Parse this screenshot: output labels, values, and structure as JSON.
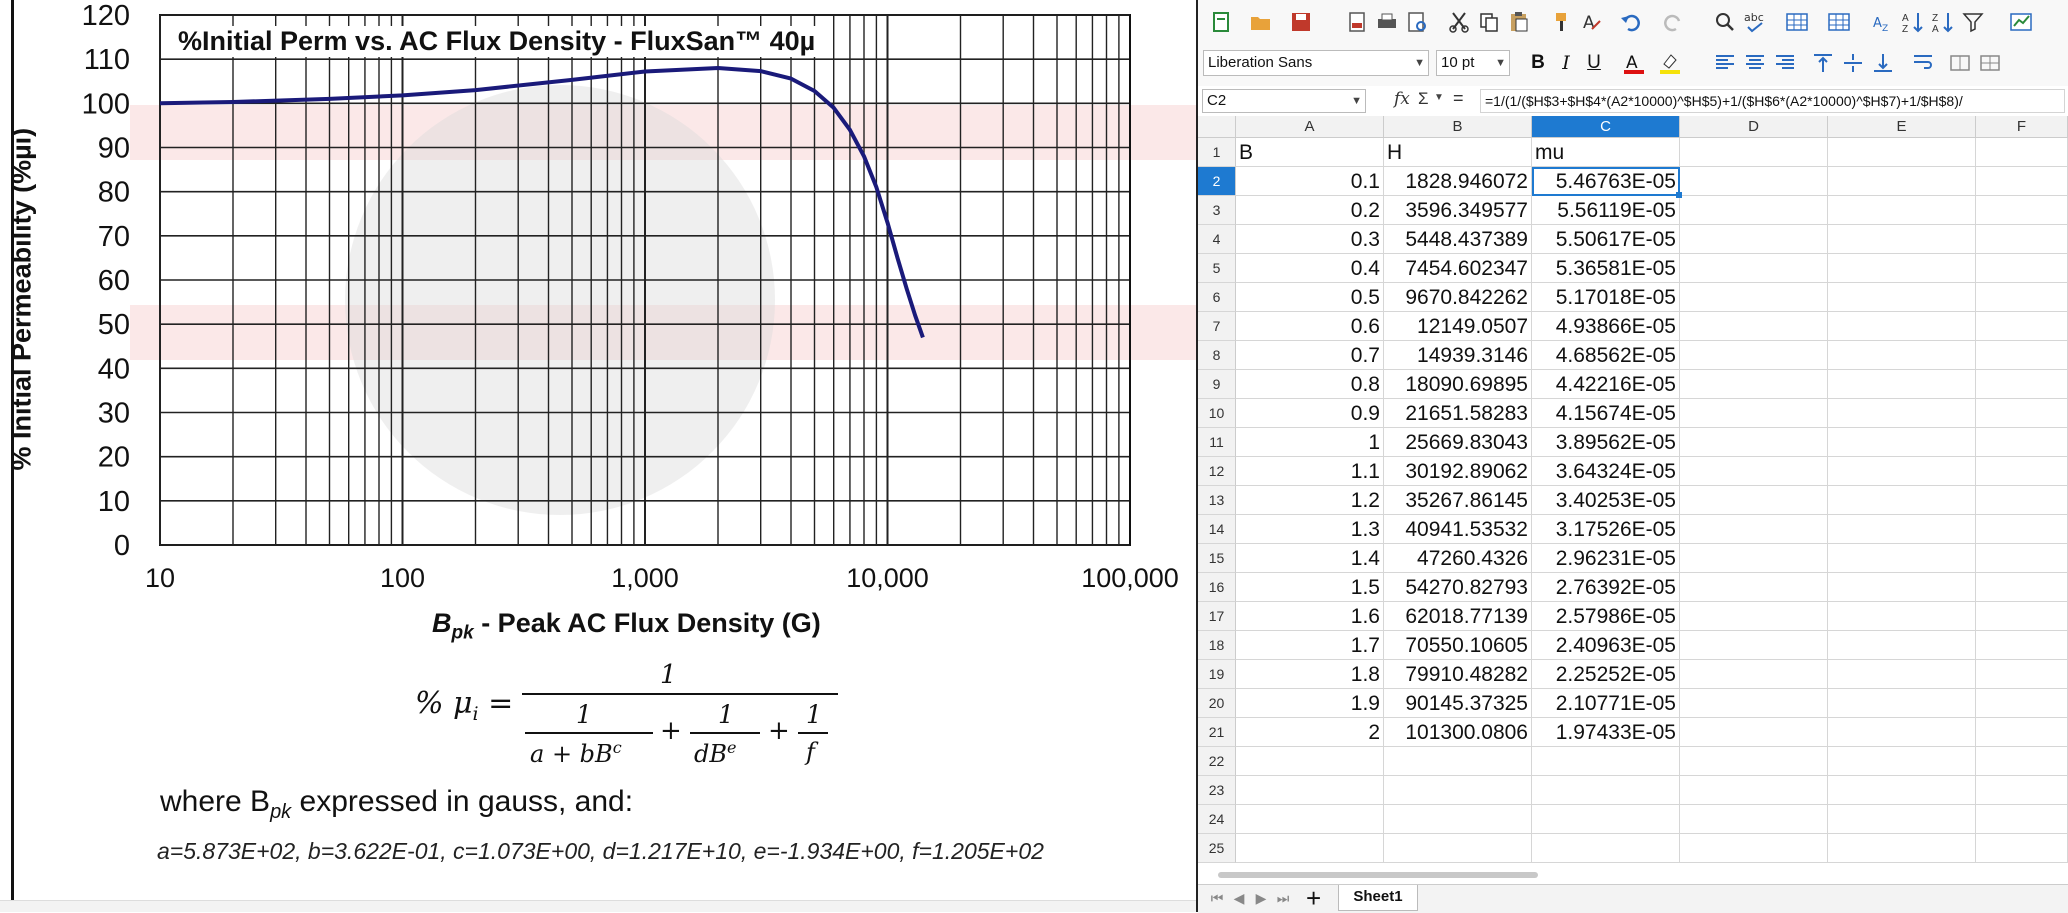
{
  "chart_data": {
    "type": "line",
    "title": "%Initial Perm vs. AC Flux Density - FluxSan™ 40µ",
    "xlabel": "B<sub>pk</sub> - Peak AC Flux Density (G)",
    "xlabel_main": "B",
    "xlabel_sub": "pk",
    "xlabel_rest": " - Peak AC Flux Density (G)",
    "ylabel": "% Initial Permeability (%µi)",
    "xscale": "log",
    "xlim": [
      10,
      100000
    ],
    "ylim": [
      0,
      120
    ],
    "x_ticks": [
      "10",
      "100",
      "1,000",
      "10,000",
      "100,000"
    ],
    "y_ticks": [
      "0",
      "10",
      "20",
      "30",
      "40",
      "50",
      "60",
      "70",
      "80",
      "90",
      "100",
      "110",
      "120"
    ],
    "grid": true,
    "series": [
      {
        "color": "#1a1a7a",
        "x": [
          10,
          20,
          50,
          100,
          200,
          500,
          1000,
          2000,
          3000,
          4000,
          5000,
          6000,
          7000,
          8000,
          9000,
          10000,
          11000,
          12000,
          13000,
          14000
        ],
        "y": [
          100,
          100.3,
          101,
          101.8,
          103,
          105.3,
          107.2,
          108,
          107.3,
          105.6,
          102.8,
          99,
          94,
          88,
          81,
          73,
          65,
          58,
          52,
          47
        ]
      }
    ]
  },
  "formula": {
    "lhs": "% μ",
    "lhs_sub": "i",
    "numerator": "1",
    "term1_num": "1",
    "term1_den": "a + bB",
    "term1_exp": "c",
    "term2_num": "1",
    "term2_den": "dB",
    "term2_exp": "e",
    "term3_num": "1",
    "term3_den": "f"
  },
  "description": {
    "line1_pre": "where B",
    "line1_sub": "pk",
    "line1_post": " expressed in gauss, and:",
    "coefficients": "a=5.873E+02, b=3.622E-01, c=1.073E+00, d=1.217E+10, e=-1.934E+00, f=1.205E+02"
  },
  "spreadsheet": {
    "font_name": "Liberation Sans",
    "font_size": "10 pt",
    "name_box": "C2",
    "formula": "=1/(1/($H$3+$H$4*(A2*10000)^$H$5)+1/($H$6*(A2*10000)^$H$7)+1/$H$8)/",
    "columns": [
      "A",
      "B",
      "C",
      "D",
      "E",
      "F"
    ],
    "headers": [
      "B",
      "H",
      "mu"
    ],
    "rows": [
      [
        "0.1",
        "1828.946072",
        "5.46763E-05"
      ],
      [
        "0.2",
        "3596.349577",
        "5.56119E-05"
      ],
      [
        "0.3",
        "5448.437389",
        "5.50617E-05"
      ],
      [
        "0.4",
        "7454.602347",
        "5.36581E-05"
      ],
      [
        "0.5",
        "9670.842262",
        "5.17018E-05"
      ],
      [
        "0.6",
        "12149.0507",
        "4.93866E-05"
      ],
      [
        "0.7",
        "14939.3146",
        "4.68562E-05"
      ],
      [
        "0.8",
        "18090.69895",
        "4.42216E-05"
      ],
      [
        "0.9",
        "21651.58283",
        "4.15674E-05"
      ],
      [
        "1",
        "25669.83043",
        "3.89562E-05"
      ],
      [
        "1.1",
        "30192.89062",
        "3.64324E-05"
      ],
      [
        "1.2",
        "35267.86145",
        "3.40253E-05"
      ],
      [
        "1.3",
        "40941.53532",
        "3.17526E-05"
      ],
      [
        "1.4",
        "47260.4326",
        "2.96231E-05"
      ],
      [
        "1.5",
        "54270.82793",
        "2.76392E-05"
      ],
      [
        "1.6",
        "62018.77139",
        "2.57986E-05"
      ],
      [
        "1.7",
        "70550.10605",
        "2.40963E-05"
      ],
      [
        "1.8",
        "79910.48282",
        "2.25252E-05"
      ],
      [
        "1.9",
        "90145.37325",
        "2.10771E-05"
      ],
      [
        "2",
        "101300.0806",
        "1.97433E-05"
      ]
    ],
    "row_numbers": [
      "1",
      "2",
      "3",
      "4",
      "5",
      "6",
      "7",
      "8",
      "9",
      "10",
      "11",
      "12",
      "13",
      "14",
      "15",
      "16",
      "17",
      "18",
      "19",
      "20",
      "21",
      "22",
      "23",
      "24",
      "25"
    ],
    "sheet_tab": "Sheet1",
    "add_sheet": "+",
    "font_buttons": [
      "B",
      "I",
      "U"
    ],
    "fx_label": "fx",
    "sigma_label": "Σ",
    "eq_label": "="
  }
}
